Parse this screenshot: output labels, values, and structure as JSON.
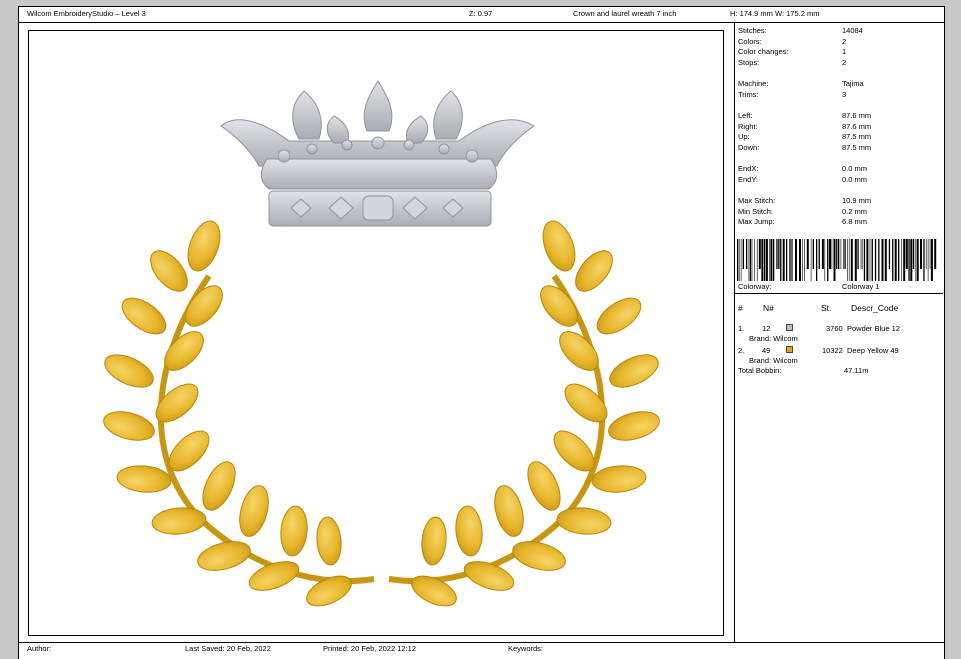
{
  "header": {
    "app_title": "Wilcom EmbroideryStudio – Level 3",
    "zoom": "Z: 0.97",
    "design_name": "Crown and laurel wreath 7 inch",
    "dimensions": "H: 174.9 mm   W: 175.2 mm"
  },
  "stats": [
    {
      "label": "Stitches:",
      "value": "14084"
    },
    {
      "label": "Colors:",
      "value": "2"
    },
    {
      "label": "Color changes:",
      "value": "1"
    },
    {
      "label": "Stops:",
      "value": "2"
    },
    {
      "label": "Machine:",
      "value": "Tajima"
    },
    {
      "label": "Trims:",
      "value": "3"
    },
    {
      "label": "Left:",
      "value": "87.6 mm"
    },
    {
      "label": "Right:",
      "value": "87.6 mm"
    },
    {
      "label": "Up:",
      "value": "87.5 mm"
    },
    {
      "label": "Down:",
      "value": "87.5 mm"
    },
    {
      "label": "EndX:",
      "value": "0.0 mm"
    },
    {
      "label": "EndY:",
      "value": "0.0 mm"
    },
    {
      "label": "Max Stitch:",
      "value": "10.9 mm"
    },
    {
      "label": "Min Stitch:",
      "value": "0.2 mm"
    },
    {
      "label": "Max Jump:",
      "value": "6.8 mm"
    }
  ],
  "colorway": {
    "label": "Colorway:",
    "value": "Colorway 1"
  },
  "table": {
    "headers": [
      "#",
      "N#",
      "St.",
      "Descr_Code"
    ],
    "rows": [
      {
        "index": "1.",
        "needle": "12",
        "color": "#b8bdd6",
        "stitches": "3760",
        "descr": "Powder Blue 12",
        "brand": "Brand: Wilcom"
      },
      {
        "index": "2.",
        "needle": "49",
        "color": "#f0a020",
        "stitches": "10322",
        "descr": "Deep Yellow 49",
        "brand": "Brand: Wilcom"
      }
    ],
    "total_label": "Total Bobbin:",
    "total_value": "47.11m"
  },
  "footer": {
    "author": "Author:",
    "last_saved": "Last Saved: 20 Feb, 2022",
    "printed": "Printed: 20 Feb, 2022 12:12",
    "keywords": "Keywords:"
  },
  "colors": {
    "crown": "#c4c6cc",
    "crown_dark": "#9ea1a8",
    "gold": "#e7b52a",
    "gold_dark": "#b98a12"
  }
}
